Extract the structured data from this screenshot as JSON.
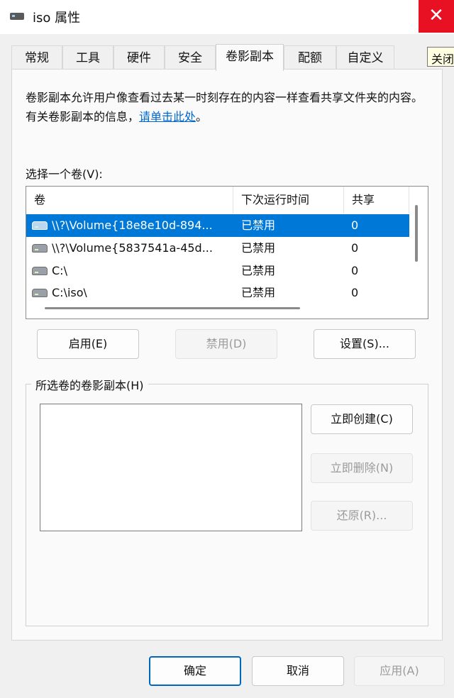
{
  "window": {
    "title": "iso 属性",
    "close_glyph": "✕",
    "tooltip": "关闭"
  },
  "tabs": [
    {
      "label": "常规"
    },
    {
      "label": "工具"
    },
    {
      "label": "硬件"
    },
    {
      "label": "安全"
    },
    {
      "label": "卷影副本",
      "active": true
    },
    {
      "label": "配额"
    },
    {
      "label": "自定义"
    }
  ],
  "description": {
    "text": "卷影副本允许用户像查看过去某一时刻存在的内容一样查看共享文件夹的内容。有关卷影副本的信息，",
    "link": "请单击此处",
    "suffix": "。"
  },
  "volume_section": {
    "label": "选择一个卷(V):",
    "columns": [
      "卷",
      "下次运行时间",
      "共享"
    ],
    "rows": [
      {
        "volume": "\\\\?\\Volume{18e8e10d-894...",
        "next_run": "已禁用",
        "shares": "0",
        "icon": "drive-icon"
      },
      {
        "volume": "\\\\?\\Volume{5837541a-45d...",
        "next_run": "已禁用",
        "shares": "0",
        "icon": "drive-icon"
      },
      {
        "volume": "C:\\",
        "next_run": "已禁用",
        "shares": "0",
        "icon": "drive-icon"
      },
      {
        "volume": "C:\\iso\\",
        "next_run": "已禁用",
        "shares": "0",
        "icon": "drive-icon"
      }
    ],
    "buttons": {
      "enable": "启用(E)",
      "disable": "禁用(D)",
      "settings": "设置(S)..."
    }
  },
  "snapshots_section": {
    "label": "所选卷的卷影副本(H)",
    "buttons": {
      "create_now": "立即创建(C)",
      "delete_now": "立即删除(N)",
      "revert": "还原(R)..."
    }
  },
  "footer": {
    "ok": "确定",
    "cancel": "取消",
    "apply": "应用(A)"
  },
  "colors": {
    "selection": "#0078d7",
    "link": "#0066cc",
    "close": "#e81123",
    "default_button_border": "#0067c0"
  }
}
